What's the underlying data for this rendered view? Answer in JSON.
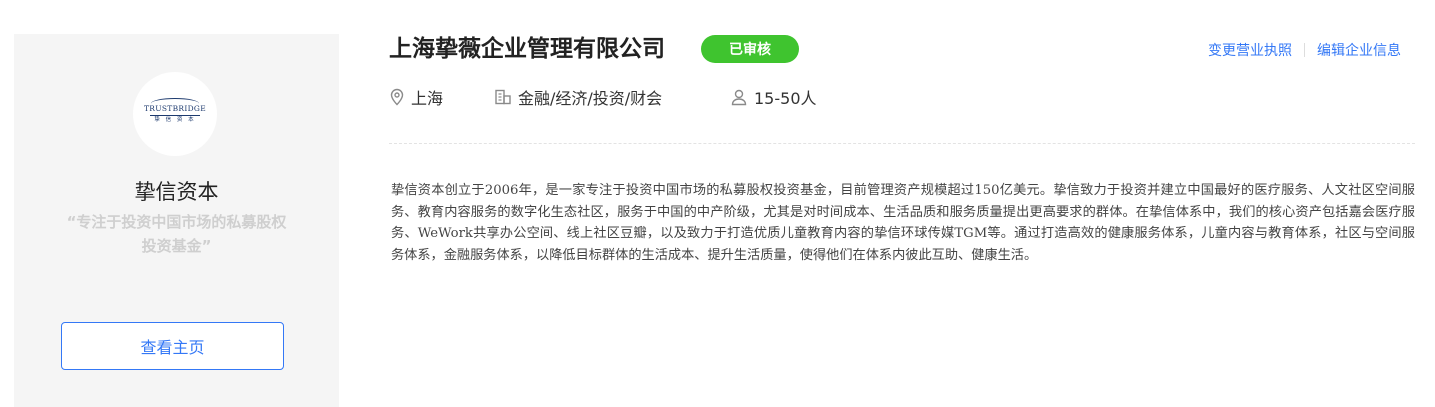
{
  "company": {
    "short_name": "挚信资本",
    "slogan": "“专注于投资中国市场的私募股权投资基金”",
    "full_name": "上海挚薇企业管理有限公司",
    "status_badge": "已审核",
    "logo": {
      "top_text": "TRUSTBRIDGE",
      "sub_text": "挚 信 资 本"
    },
    "location": "上海",
    "industry": "金融/经济/投资/财会",
    "size": "15-50人",
    "description": "挚信资本创立于2006年，是一家专注于投资中国市场的私募股权投资基金，目前管理资产规模超过150亿美元。挚信致力于投资并建立中国最好的医疗服务、人文社区空间服务、教育内容服务的数字化生态社区，服务于中国的中产阶级，尤其是对时间成本、生活品质和服务质量提出更高要求的群体。在挚信体系中，我们的核心资产包括嘉会医疗服务、WeWork共享办公空间、线上社区豆瓣，以及致力于打造优质儿童教育内容的挚信环球传媒TGM等。通过打造高效的健康服务体系，儿童内容与教育体系，社区与空间服务体系，金融服务体系，以降低目标群体的生活成本、提升生活质量，使得他们在体系内彼此互助、健康生活。"
  },
  "actions": {
    "change_license": "变更营业执照",
    "edit_info": "编辑企业信息"
  },
  "buttons": {
    "view_homepage": "查看主页"
  },
  "icons": {
    "location": "location-pin-icon",
    "industry": "building-icon",
    "size": "person-icon"
  },
  "colors": {
    "accent": "#3478f6",
    "badge": "#3fc42f",
    "card_bg": "#f5f5f5"
  }
}
